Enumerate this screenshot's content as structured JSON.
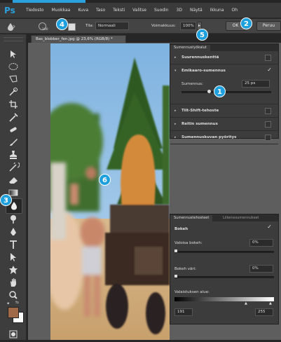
{
  "app": {
    "logo": "Ps"
  },
  "menubar": {
    "items": [
      "Tiedosto",
      "Muokkaa",
      "Kuva",
      "Taso",
      "Teksti",
      "Valitse",
      "Suodin",
      "3D",
      "Näytä",
      "Ikkuna",
      "Oh"
    ]
  },
  "options": {
    "size_value": "100",
    "mode_label": "Tila:",
    "mode_value": "Normaali",
    "strength_label": "Voimakkuus:",
    "strength_value": "100%",
    "ok_label": "OK",
    "cancel_label": "Peruu"
  },
  "document": {
    "tab_label": "Bas_blobber_fen.jpg @ 23,6% (RGB/8) *"
  },
  "blur_gallery": {
    "tab_label": "Sumennustyökalut",
    "items": [
      {
        "label": "Suurennuskenttä",
        "expanded": false,
        "checked": false
      },
      {
        "label": "Emikaaro-sumennus",
        "expanded": true,
        "checked": true
      },
      {
        "label": "Tilt-Shift-tehoste",
        "expanded": false,
        "checked": false
      },
      {
        "label": "Reitin sumennus",
        "expanded": false,
        "checked": false
      },
      {
        "label": "Sumennuskuvan pyöritys",
        "expanded": false,
        "checked": false
      }
    ],
    "sub_label": "Sumennus:",
    "sub_value": "25 px"
  },
  "effects_panel": {
    "tabs": [
      "Sumennustehosteet",
      "Liikenesumennukset"
    ],
    "bokeh_label": "Bokeh",
    "light_label": "Valoisa bokeh:",
    "light_value": "0%",
    "color_label": "Bokeh väri:",
    "color_value": "0%",
    "range_label": "Valaistuksen alue:",
    "range_low": "191",
    "range_high": "255"
  },
  "callouts": [
    "1",
    "2",
    "3",
    "4",
    "5",
    "6"
  ],
  "colors": {
    "accent": "#1ea0df",
    "foreground_swatch": "#a06a48",
    "background_swatch": "#ffffff"
  }
}
